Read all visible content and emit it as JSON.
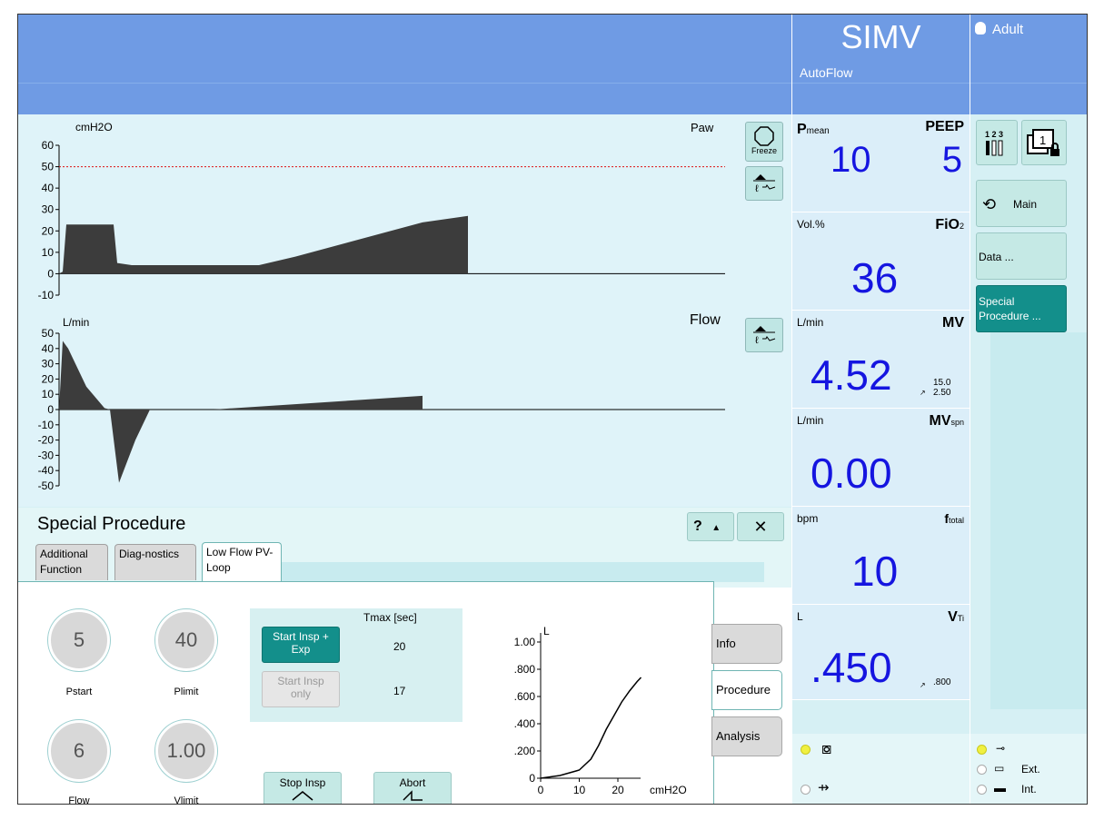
{
  "header": {
    "mode": "SIMV",
    "submode": "AutoFlow",
    "patient": "Adult"
  },
  "colors": {
    "header_bg": "#6f9be4",
    "value_blue": "#1515e0",
    "teal_button": "#138f8b",
    "alarm_line": "#d11"
  },
  "waveforms": {
    "pressure": {
      "unit": "cmH2O",
      "name": "Paw",
      "ticks": [
        "60",
        "50",
        "40",
        "30",
        "20",
        "10",
        "0",
        "-10"
      ],
      "alarm_limit": 50,
      "freeze_label": "Freeze"
    },
    "flow": {
      "unit": "L/min",
      "name": "Flow",
      "ticks": [
        "50",
        "40",
        "30",
        "20",
        "10",
        "0",
        "-10",
        "-20",
        "-30",
        "-40",
        "-50"
      ]
    }
  },
  "monitoring": [
    {
      "unit": "",
      "name": "Pmean",
      "value": "10"
    },
    {
      "unit": "",
      "name": "PEEP",
      "value": "5"
    },
    {
      "unit": "Vol.%",
      "name": "FiO2",
      "value": "36"
    },
    {
      "unit": "L/min",
      "name": "MV",
      "value": "4.52",
      "limit_hi": "15.0",
      "limit_lo": "2.50"
    },
    {
      "unit": "L/min",
      "name": "MVspn",
      "value": "0.00"
    },
    {
      "unit": "bpm",
      "name": "ftotal",
      "value": "10"
    },
    {
      "unit": "L",
      "name": "VTi",
      "value": ".450",
      "limit": ".800"
    }
  ],
  "nav": {
    "main": "Main",
    "data": "Data ...",
    "special": "Special Procedure ..."
  },
  "special_procedure": {
    "title": "Special Procedure",
    "help": "?",
    "tabs": [
      "Additional Function",
      "Diag-nostics",
      "Low Flow PV-Loop"
    ],
    "knobs": [
      {
        "label": "Pstart",
        "value": "5"
      },
      {
        "label": "Plimit",
        "value": "40"
      },
      {
        "label": "Flow",
        "value": "6"
      },
      {
        "label": "Vlimit",
        "value": "1.00"
      }
    ],
    "tmax_header": "Tmax [sec]",
    "start_insp_exp": "Start Insp + Exp",
    "start_insp_only": "Start Insp only",
    "tmax_values": [
      "20",
      "17"
    ],
    "stop_insp": "Stop Insp",
    "abort": "Abort",
    "side_tabs": [
      "Info",
      "Procedure",
      "Analysis"
    ],
    "loop": {
      "y_unit": "L",
      "x_unit": "cmH2O",
      "y_ticks": [
        "1.00",
        ".800",
        ".600",
        ".400",
        ".200",
        "0"
      ],
      "x_ticks": [
        "0",
        "10",
        "20"
      ]
    }
  },
  "status": {
    "ext": "Ext.",
    "int": "Int."
  },
  "chart_data": [
    {
      "type": "area",
      "ylabel": "cmH2O",
      "ylim": [
        -10,
        60
      ],
      "x": [
        0,
        2,
        4,
        30,
        32,
        40,
        110,
        130,
        200,
        225
      ],
      "values": [
        0,
        1,
        23,
        23,
        5,
        4,
        4,
        8,
        24,
        27
      ]
    },
    {
      "type": "area",
      "ylabel": "L/min",
      "ylim": [
        -50,
        50
      ],
      "x": [
        0,
        2,
        5,
        15,
        25,
        28,
        33,
        42,
        50,
        85,
        200
      ],
      "values": [
        0,
        45,
        40,
        15,
        1,
        0,
        -48,
        -20,
        0,
        0,
        9
      ]
    },
    {
      "type": "line",
      "xlabel": "cmH2O",
      "ylabel": "L",
      "xlim": [
        0,
        40
      ],
      "ylim": [
        0,
        1.0
      ],
      "x": [
        0,
        5,
        10,
        13,
        15,
        17,
        19,
        21,
        23,
        25,
        26
      ],
      "values": [
        0,
        0.02,
        0.06,
        0.14,
        0.24,
        0.36,
        0.46,
        0.56,
        0.64,
        0.71,
        0.74
      ]
    }
  ]
}
